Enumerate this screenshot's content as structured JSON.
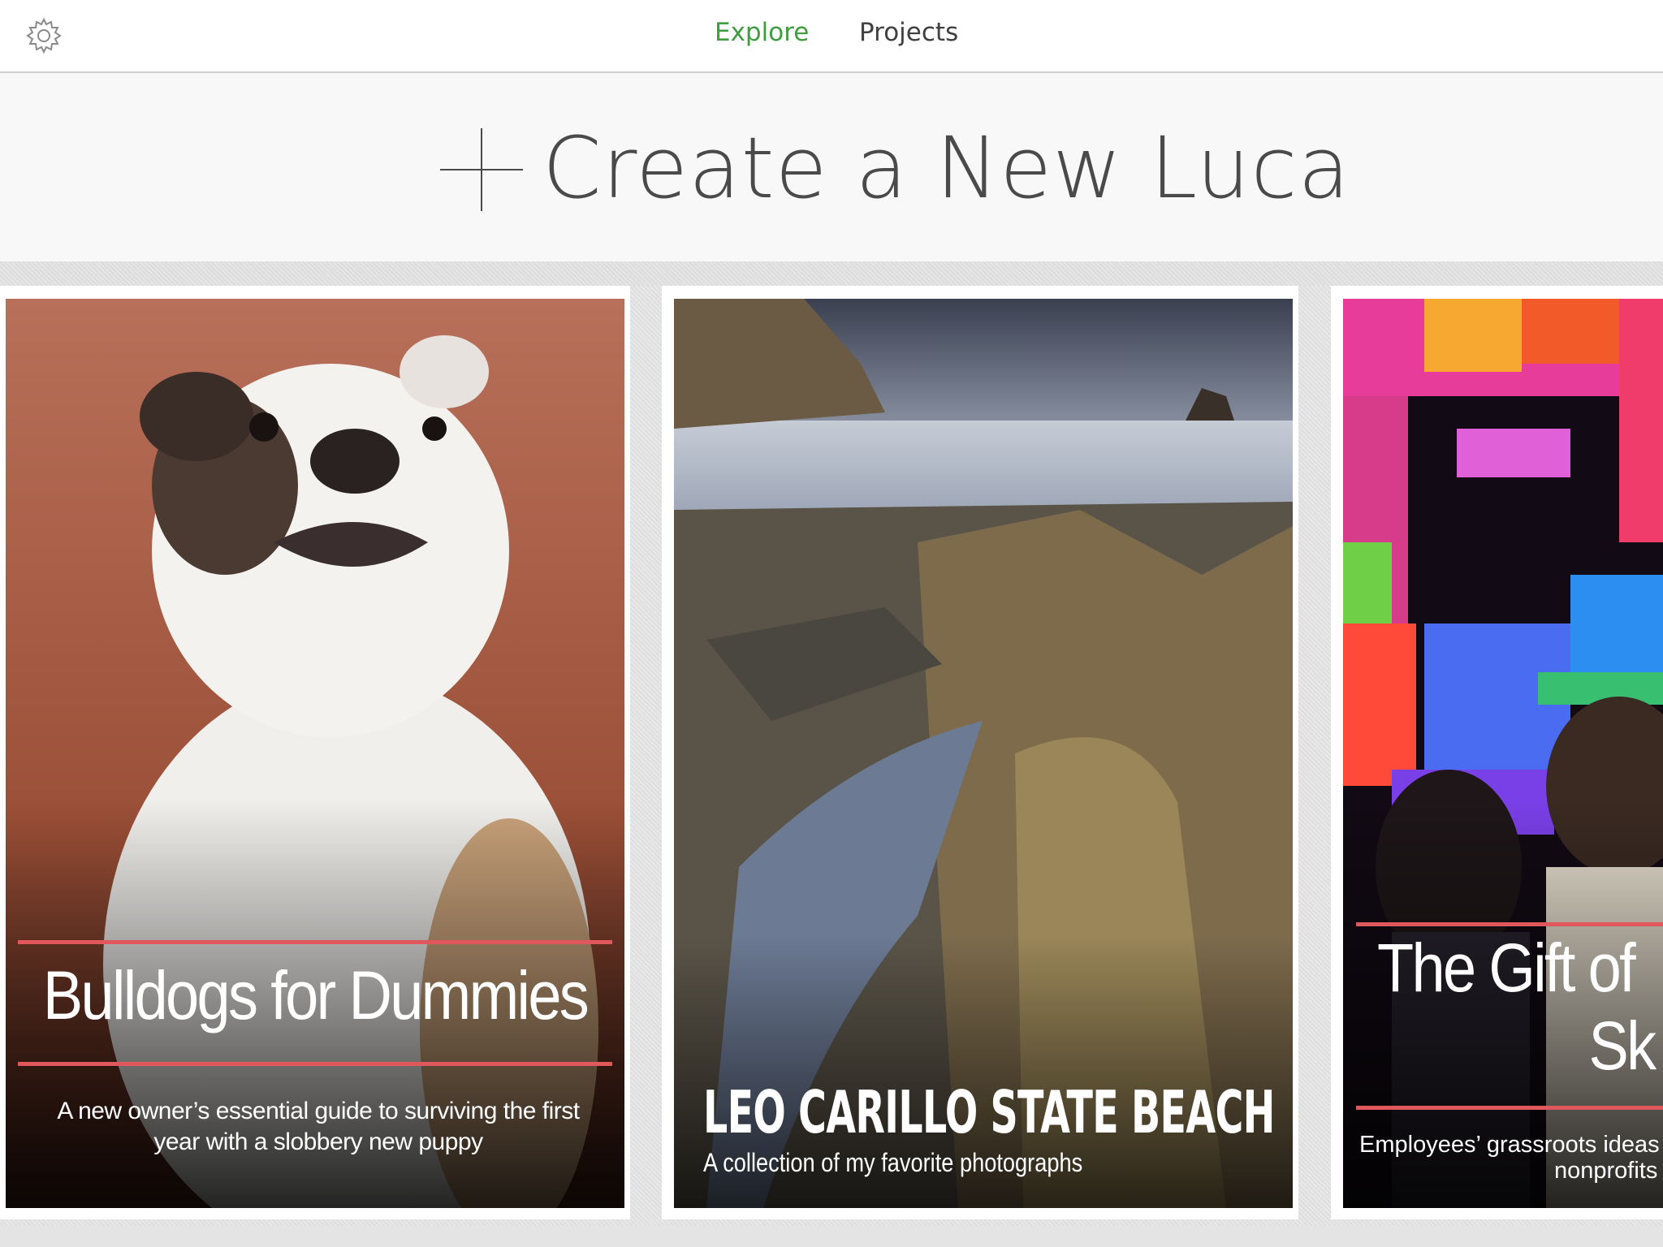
{
  "nav": {
    "settings_icon": "gear-icon",
    "tabs": [
      {
        "label": "Explore",
        "active": true,
        "color": "#3f9d3f"
      },
      {
        "label": "Projects",
        "active": false
      }
    ]
  },
  "create": {
    "icon": "plus-icon",
    "label": "Create a New Luca"
  },
  "cards": [
    {
      "title": "Bulldogs for Dummies",
      "subtitle_line1": "A new owner’s essential guide to surviving the first",
      "subtitle_line2": "year with a slobbery new puppy",
      "accent": "#e0585b"
    },
    {
      "title": "LEO CARILLO STATE BEACH",
      "subtitle": "A collection of my favorite photographs"
    },
    {
      "title_line1": "The Gift of",
      "title_line2": "Sk",
      "subtitle_line1": "Employees’ grassroots ideas",
      "subtitle_line2": "nonprofits",
      "accent": "#e0585b"
    }
  ]
}
